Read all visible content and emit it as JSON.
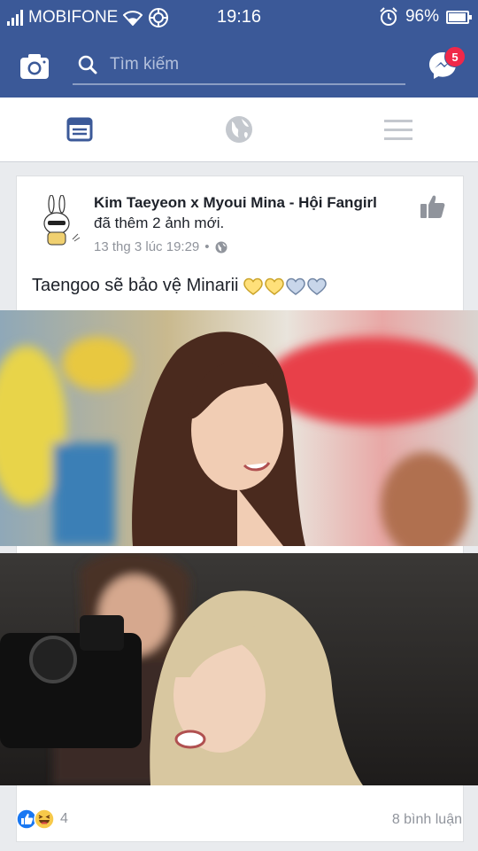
{
  "status_bar": {
    "carrier": "MOBIFONE",
    "time": "19:16",
    "battery_percent": "96%",
    "battery_level": 0.96
  },
  "top_bar": {
    "search_placeholder": "Tìm kiếm",
    "messenger_badge": "5"
  },
  "tabs": [
    {
      "name": "news-feed",
      "icon": "news-feed-icon",
      "active": true
    },
    {
      "name": "notifications",
      "icon": "globe-icon",
      "active": false
    },
    {
      "name": "menu",
      "icon": "hamburger-menu-icon",
      "active": false
    }
  ],
  "post": {
    "page_name": "Kim Taeyeon x Myoui Mina - Hội Fangirl",
    "action": "đã thêm 2 ảnh mới.",
    "timestamp": "13 thg 3 lúc 19:29",
    "separator": "•",
    "privacy_icon": "globe-icon",
    "text": "Taengoo sẽ bảo vệ Minarii",
    "emojis": [
      "yellow-heart",
      "yellow-heart",
      "blue-heart",
      "blue-heart"
    ],
    "reaction_count": "4",
    "comments": "8 bình luận"
  },
  "colors": {
    "brand": "#3b5998",
    "badge": "#f02849",
    "meta_text": "#90949c",
    "like_blue": "#1877f2"
  }
}
